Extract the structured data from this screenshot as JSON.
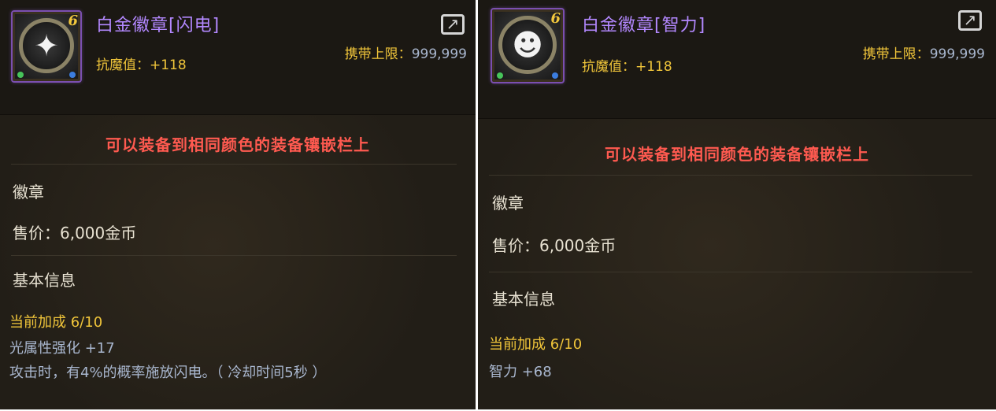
{
  "cards": [
    {
      "icon": "lightning-star-badge-icon",
      "level": "6",
      "name": "白金徽章[闪电]",
      "resist": "抗魔值：+118",
      "limit_label": "携带上限：",
      "limit_value": "999,999",
      "notice": "可以装备到相同颜色的装备镶嵌栏上",
      "type": "徽章",
      "price": "售价：6,000金币",
      "section": "基本信息",
      "bonus_label": "当前加成 ",
      "bonus_value": "6/10",
      "stats": [
        "光属性强化 +17",
        "攻击时，有4%的概率施放闪电。（ 冷却时间5秒 ）"
      ]
    },
    {
      "icon": "intelligence-bulb-badge-icon",
      "level": "6",
      "name": "白金徽章[智力]",
      "resist": "抗魔值：+118",
      "limit_label": "携带上限：",
      "limit_value": "999,999",
      "notice": "可以装备到相同颜色的装备镶嵌栏上",
      "type": "徽章",
      "price": "售价：6,000金币",
      "section": "基本信息",
      "bonus_label": "当前加成 ",
      "bonus_value": "6/10",
      "stats": [
        "智力 +68"
      ]
    }
  ]
}
